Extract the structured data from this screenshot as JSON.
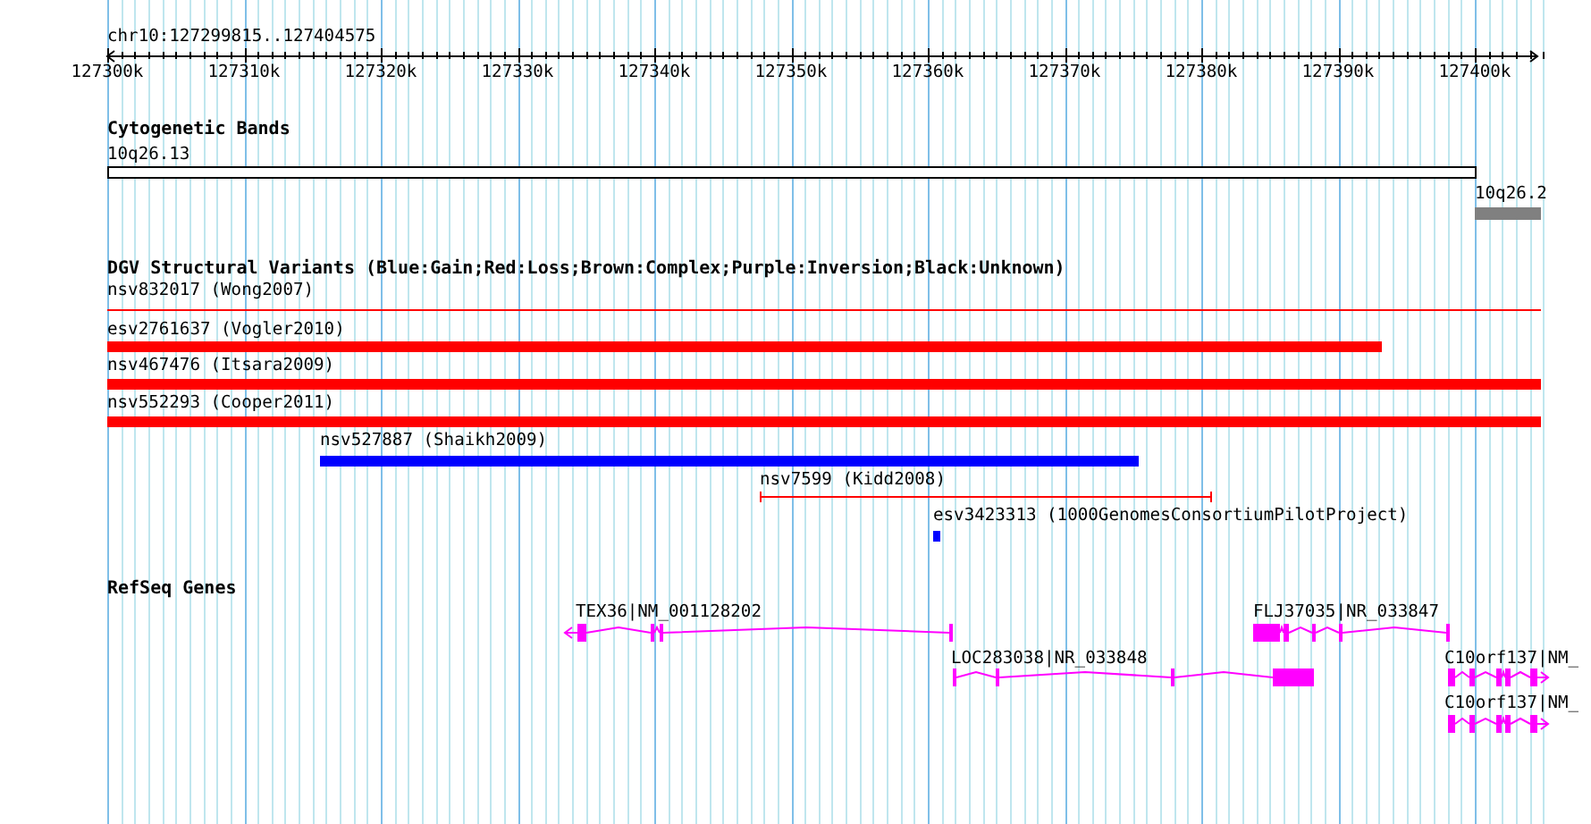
{
  "ruler": {
    "title": "chr10:127299815..127404575",
    "ticks": [
      "127300k",
      "127310k",
      "127320k",
      "127330k",
      "127340k",
      "127350k",
      "127360k",
      "127370k",
      "127380k",
      "127390k",
      "127400k"
    ]
  },
  "tracks": [
    {
      "title": "Cytogenetic Bands",
      "kind": "bands",
      "features": [
        {
          "label": "10q26.13",
          "color": "#ffffff"
        },
        {
          "label": "10q26.2",
          "color": "#808080"
        }
      ]
    },
    {
      "title": "DGV Structural Variants (Blue:Gain;Red:Loss;Brown:Complex;Purple:Inversion;Black:Unknown)",
      "kind": "variants",
      "features": [
        {
          "label": "nsv832017 (Wong2007)",
          "kind": "line",
          "color": "#ff0000"
        },
        {
          "label": "esv2761637 (Vogler2010)",
          "kind": "bar",
          "color": "#ff0000"
        },
        {
          "label": "nsv467476 (Itsara2009)",
          "kind": "bar",
          "color": "#ff0000"
        },
        {
          "label": "nsv552293 (Cooper2011)",
          "kind": "bar",
          "color": "#ff0000"
        },
        {
          "label": "nsv527887 (Shaikh2009)",
          "kind": "bar",
          "color": "#0000ff"
        },
        {
          "label": "nsv7599 (Kidd2008)",
          "kind": "span",
          "color": "#ff0000"
        },
        {
          "label": "esv3423313 (1000GenomesConsortiumPilotProject)",
          "kind": "bar",
          "color": "#0000ff"
        }
      ]
    },
    {
      "title": "RefSeq Genes",
      "kind": "genes",
      "features": [
        {
          "label": "TEX36|NM_001128202"
        },
        {
          "label": "LOC283038|NR_033848"
        },
        {
          "label": "FLJ37035|NR_033847"
        },
        {
          "label": "C10orf137|NM_"
        },
        {
          "label": "C10orf137|NM_"
        }
      ]
    }
  ]
}
